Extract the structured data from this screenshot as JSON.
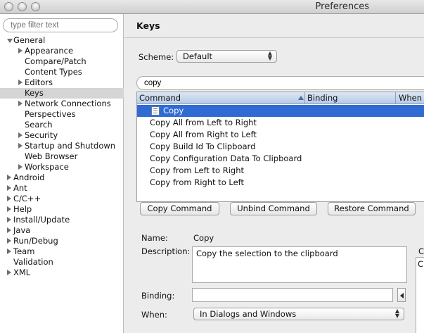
{
  "window": {
    "title": "Preferences"
  },
  "sidebar": {
    "filter_placeholder": "type filter text",
    "tree": [
      {
        "label": "General",
        "indent": 0,
        "twisty": "open"
      },
      {
        "label": "Appearance",
        "indent": 1,
        "twisty": "closed"
      },
      {
        "label": "Compare/Patch",
        "indent": 1,
        "twisty": "none"
      },
      {
        "label": "Content Types",
        "indent": 1,
        "twisty": "none"
      },
      {
        "label": "Editors",
        "indent": 1,
        "twisty": "closed"
      },
      {
        "label": "Keys",
        "indent": 1,
        "twisty": "none",
        "selected": true
      },
      {
        "label": "Network Connections",
        "indent": 1,
        "twisty": "closed"
      },
      {
        "label": "Perspectives",
        "indent": 1,
        "twisty": "none"
      },
      {
        "label": "Search",
        "indent": 1,
        "twisty": "none"
      },
      {
        "label": "Security",
        "indent": 1,
        "twisty": "closed"
      },
      {
        "label": "Startup and Shutdown",
        "indent": 1,
        "twisty": "closed"
      },
      {
        "label": "Web Browser",
        "indent": 1,
        "twisty": "none"
      },
      {
        "label": "Workspace",
        "indent": 1,
        "twisty": "closed"
      },
      {
        "label": "Android",
        "indent": 0,
        "twisty": "closed"
      },
      {
        "label": "Ant",
        "indent": 0,
        "twisty": "closed"
      },
      {
        "label": "C/C++",
        "indent": 0,
        "twisty": "closed"
      },
      {
        "label": "Help",
        "indent": 0,
        "twisty": "closed"
      },
      {
        "label": "Install/Update",
        "indent": 0,
        "twisty": "closed"
      },
      {
        "label": "Java",
        "indent": 0,
        "twisty": "closed"
      },
      {
        "label": "Run/Debug",
        "indent": 0,
        "twisty": "closed"
      },
      {
        "label": "Team",
        "indent": 0,
        "twisty": "closed"
      },
      {
        "label": "Validation",
        "indent": 0,
        "twisty": "none"
      },
      {
        "label": "XML",
        "indent": 0,
        "twisty": "closed"
      }
    ]
  },
  "main": {
    "title": "Keys",
    "scheme_label": "Scheme:",
    "scheme_value": "Default",
    "search_value": "copy",
    "table": {
      "headers": {
        "command": "Command",
        "binding": "Binding",
        "when": "When"
      },
      "rows": [
        {
          "command": "Copy",
          "selected": true,
          "icon": "document-icon"
        },
        {
          "command": "Copy All from Left to Right"
        },
        {
          "command": "Copy All from Right to Left"
        },
        {
          "command": "Copy Build Id To Clipboard"
        },
        {
          "command": "Copy Configuration Data To Clipboard"
        },
        {
          "command": "Copy from Left to Right"
        },
        {
          "command": "Copy from Right to Left"
        }
      ]
    },
    "buttons": {
      "copy_command": "Copy Command",
      "unbind_command": "Unbind Command",
      "restore_command": "Restore Command"
    },
    "details": {
      "name_label": "Name:",
      "name_value": "Copy",
      "description_label": "Description:",
      "description_value": "Copy the selection to the clipboard",
      "binding_label": "Binding:",
      "binding_value": "",
      "when_label": "When:",
      "when_value": "In Dialogs and Windows",
      "conflicts_label": "C",
      "conflicts_first": "C"
    }
  },
  "colors": {
    "selection_blue": "#2f6bd3",
    "header_blue": "#c6d6ec",
    "sidebar_selection": "#d5d5d5"
  }
}
